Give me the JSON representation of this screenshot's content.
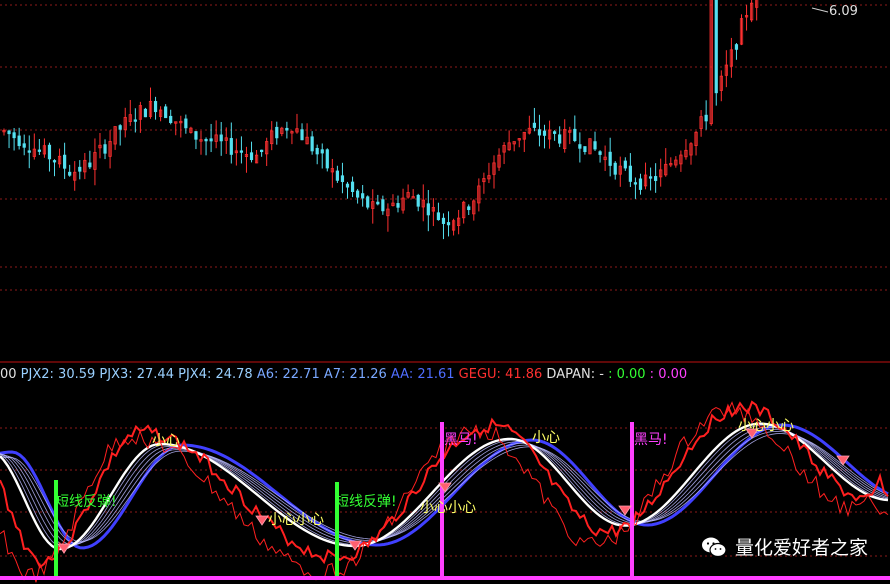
{
  "colors": {
    "background": "#000000",
    "grid": "#8b1a1a",
    "separator": "#c01010",
    "candle_up": "#ff3030",
    "candle_down": "#55e0f0",
    "line_red": "#ff2020",
    "line_white": "#ffffff",
    "line_blue": "#4040ff",
    "bull_signal": "#33ff33",
    "dark_horse_signal": "#ff40ff",
    "caution_text": "#ffff66",
    "bottom_band": "#ff40ff"
  },
  "price_panel": {
    "peak_label": "6.09"
  },
  "indicator_legend": [
    {
      "text": "00",
      "color": "#e0e0e0"
    },
    {
      "text": " PJX2: 30.59",
      "color": "#9ad0ff"
    },
    {
      "text": " PJX3: 27.44",
      "color": "#9ad0ff"
    },
    {
      "text": " PJX4: 24.78",
      "color": "#9ad0ff"
    },
    {
      "text": " A6: 22.71",
      "color": "#7aa8ff"
    },
    {
      "text": " A7: 21.26",
      "color": "#7aa8ff"
    },
    {
      "text": " AA: 21.61",
      "color": "#4f6dff"
    },
    {
      "text": " GEGU: 41.86",
      "color": "#ff3030"
    },
    {
      "text": " DAPAN: - ",
      "color": "#e0e0e0"
    },
    {
      "text": ": 0.00",
      "color": "#33ff33"
    },
    {
      "text": " : 0.00",
      "color": "#ff40ff"
    }
  ],
  "annotations": {
    "short_rebound": "短线反弹!",
    "dark_horse": "黑马!",
    "caution": "小心",
    "caution_double": "小心小心"
  },
  "watermark": {
    "text": "量化爱好者之家"
  },
  "chart_data": [
    {
      "type": "candlestick",
      "title": "",
      "marked_high": 6.09,
      "close_trend": [
        4.45,
        4.42,
        4.38,
        4.35,
        4.3,
        4.33,
        4.4,
        4.47,
        4.52,
        4.55,
        4.5,
        4.44,
        4.42,
        4.4,
        4.38,
        4.36,
        4.44,
        4.48,
        4.41,
        4.33,
        4.26,
        4.2,
        4.16,
        4.18,
        4.22,
        4.18,
        4.12,
        4.15,
        4.22,
        4.34,
        4.42,
        4.45,
        4.44,
        4.43,
        4.42,
        4.38,
        4.33,
        4.28,
        4.26,
        4.3,
        4.38,
        4.45,
        4.56,
        4.72,
        4.9,
        5.06,
        5.28,
        5.82,
        5.86,
        5.9,
        5.92,
        5.88,
        5.8
      ]
    },
    {
      "type": "line",
      "title": "",
      "series": [
        {
          "name": "PJX2",
          "last": 30.59
        },
        {
          "name": "PJX3",
          "last": 27.44
        },
        {
          "name": "PJX4",
          "last": 24.78
        },
        {
          "name": "A6",
          "last": 22.71
        },
        {
          "name": "A7",
          "last": 21.26
        },
        {
          "name": "AA",
          "last": 21.61
        },
        {
          "name": "GEGU",
          "last": 41.86
        },
        {
          "name": "DAPAN",
          "last": 0.0
        }
      ]
    }
  ]
}
